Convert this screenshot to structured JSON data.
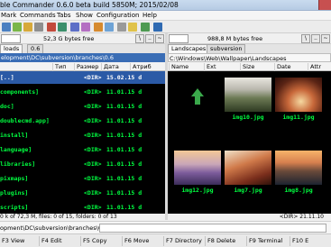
{
  "window": {
    "title": "ble Commander 0.6.0 beta build 5850M; 2015/02/08"
  },
  "menu": [
    "Mark",
    "Commands",
    "Tabs",
    "Show",
    "Configuration",
    "Help"
  ],
  "toolbar": {
    "left_free": "52,3 G bytes free",
    "right_free": "988,8 M bytes free"
  },
  "left": {
    "tab": "loads",
    "tab2": "0.6",
    "path": "elopment\\DC\\subversion\\branches\\0.6",
    "columns": [
      "Тип",
      "Размер",
      "Дата",
      "Атриб"
    ],
    "rows": [
      {
        "name": "[..]",
        "size": "<DIR>",
        "date": "15.02.15  d",
        "selected": true
      },
      {
        "name": "components]",
        "size": "<DIR>",
        "date": "11.01.15  d"
      },
      {
        "name": "doc]",
        "size": "<DIR>",
        "date": "11.01.15  d"
      },
      {
        "name": "doublecmd.app]",
        "size": "<DIR>",
        "date": "11.01.15  d"
      },
      {
        "name": "install]",
        "size": "<DIR>",
        "date": "11.01.15  d"
      },
      {
        "name": "language]",
        "size": "<DIR>",
        "date": "11.01.15  d"
      },
      {
        "name": "libraries]",
        "size": "<DIR>",
        "date": "11.01.15  d"
      },
      {
        "name": "pixmaps]",
        "size": "<DIR>",
        "date": "11.01.15  d"
      },
      {
        "name": "plugins]",
        "size": "<DIR>",
        "date": "11.01.15  d"
      },
      {
        "name": "scripts]",
        "size": "<DIR>",
        "date": "11.01.15  d"
      }
    ],
    "status": "0 k of 72,3 M, files: 0 of 15, folders: 0 of 13"
  },
  "right": {
    "tab1": "Landscapes",
    "tab2": "subversion",
    "path": "C:\\Windows\\Web\\Wallpaper\\Landscapes",
    "columns": [
      "Name",
      "Ext",
      "Size",
      "Date",
      "Attr"
    ],
    "thumbs": [
      {
        "caption": "",
        "kind": "up"
      },
      {
        "caption": "img10.jpg",
        "kind": "waterfall"
      },
      {
        "caption": "img11.jpg",
        "kind": "arch"
      },
      {
        "caption": "img12.jpg",
        "kind": "lavender"
      },
      {
        "caption": "img7.jpg",
        "kind": "rocks"
      },
      {
        "caption": "img8.jpg",
        "kind": "sea"
      }
    ],
    "status": "<DIR>  21.11.10"
  },
  "cmdline": {
    "path": "opment\\DC\\subversion\\branches\\0.6>"
  },
  "fkeys": [
    "F3 View",
    "F4 Edit",
    "F5 Copy",
    "F6 Move",
    "F7 Directory",
    "F8 Delete",
    "F9 Terminal",
    "F10 E"
  ]
}
